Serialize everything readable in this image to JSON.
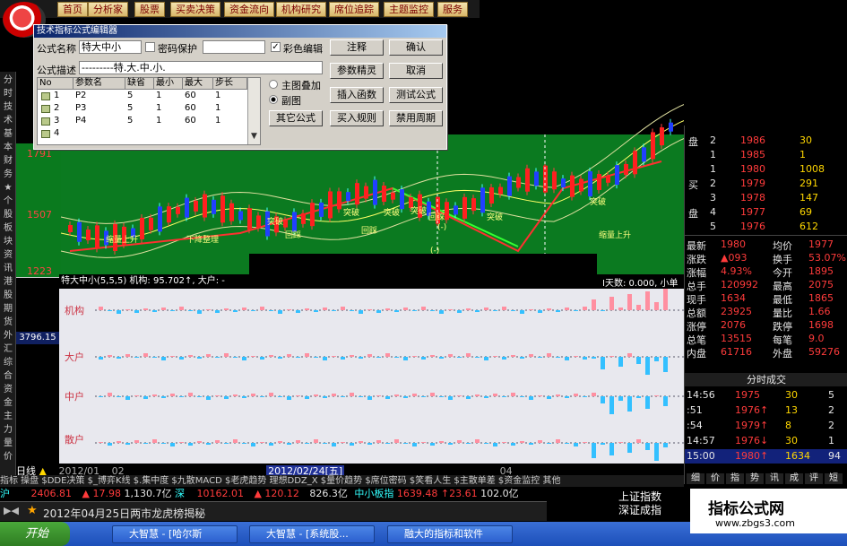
{
  "top_menu": [
    "首页",
    "分析家",
    "股票",
    "买卖决策",
    "资金流向",
    "机构研究",
    "席位追踪",
    "主题监控",
    "服务"
  ],
  "dialog": {
    "title": "技术指标公式编辑器",
    "name_label": "公式名称",
    "name_value": "特大中小",
    "password_label": "密码保护",
    "color_edit_label": "彩色编辑",
    "desc_label": "公式描述",
    "desc_value": "---------特.大.中.小.",
    "buttons": [
      "注释",
      "确认",
      "参数精灵",
      "取消",
      "插入函数",
      "测试公式",
      "其它公式",
      "买入规则",
      "禁用周期"
    ],
    "radio_main": "主图叠加",
    "radio_sub": "副图",
    "table_headers": [
      "No",
      "参数名",
      "缺省",
      "最小",
      "最大",
      "步长"
    ],
    "table_rows": [
      [
        "1",
        "P2",
        "5",
        "1",
        "60",
        "1"
      ],
      [
        "2",
        "P3",
        "5",
        "1",
        "60",
        "1"
      ],
      [
        "3",
        "P4",
        "5",
        "1",
        "60",
        "1"
      ],
      [
        "4",
        "",
        "",
        "",
        "",
        ""
      ]
    ]
  },
  "chart": {
    "prices": [
      "1791",
      "1507",
      "1223"
    ],
    "left_value": "3796.15",
    "annotations": [
      "突破",
      "回踩",
      "突破",
      "回踩",
      "突破",
      "突破",
      "回踩",
      "突破",
      "(-)",
      "(-)",
      "突破",
      "缩量上升",
      "下降整理",
      "缩量上升",
      "突破"
    ],
    "lower_header": "特大中小(5,5,5) 机构: 95.702↑, 大户: -",
    "lower_header_right": "I天数: 0.000, 小单",
    "lower_labels": [
      "机构",
      "大户",
      "中户",
      "散户"
    ]
  },
  "timeline": {
    "period_label": "日线",
    "dates": [
      "2012/01",
      "02",
      "2012/02/24[五]",
      "04"
    ]
  },
  "tabs": "指标 操盘 $DDE决策 $_博弈K线 $.集中度 $九散MACD $老虎趋势 理想DDZ_X $量价趋势 $席位密码 $笑看人生 $主散单差 $资金监控  其他",
  "index_bar": {
    "hu_label": "沪",
    "hu_value": "2406.81",
    "hu_change": "▲ 17.98",
    "hu_amount": "1,130.7亿",
    "shen_label": "深",
    "shen_value": "10162.01",
    "shen_change": "▲ 120.12",
    "shen_amount": "826.3亿",
    "zx_label": "中小板指",
    "zx_value": "1639.48",
    "zx_change": "↑23.61",
    "zx_amount": "102.0亿"
  },
  "news": "2012年04月25日两市龙虎榜揭秘",
  "taskbar": {
    "start": "开始",
    "tasks": [
      "大智慧 - [哈尔斯",
      "大智慧 - [系统股...",
      "融大的指标和软件"
    ]
  },
  "watermark": {
    "line1": "指标公式网",
    "line2": "www.zbgs3.com"
  },
  "right_panel": {
    "order_rows": [
      {
        "side": "盘",
        "n": "2",
        "price": "1986",
        "vol": "30"
      },
      {
        "side": "",
        "n": "1",
        "price": "1985",
        "vol": "1"
      },
      {
        "side": "",
        "n": "1",
        "price": "1980",
        "vol": "1008"
      },
      {
        "side": "买",
        "n": "2",
        "price": "1979",
        "vol": "291"
      },
      {
        "side": "",
        "n": "3",
        "price": "1978",
        "vol": "147"
      },
      {
        "side": "盘",
        "n": "4",
        "price": "1977",
        "vol": "69"
      },
      {
        "side": "",
        "n": "5",
        "price": "1976",
        "vol": "612"
      }
    ],
    "stats": [
      {
        "k1": "最新",
        "v1": "1980",
        "k2": "均价",
        "v2": "1977"
      },
      {
        "k1": "涨跌",
        "v1": "▲093",
        "k2": "换手",
        "v2": "53.07%"
      },
      {
        "k1": "涨幅",
        "v1": "4.93%",
        "k2": "今开",
        "v2": "1895"
      },
      {
        "k1": "总手",
        "v1": "120992",
        "k2": "最高",
        "v2": "2075"
      },
      {
        "k1": "现手",
        "v1": "1634",
        "k2": "最低",
        "v2": "1865"
      },
      {
        "k1": "总额",
        "v1": "23925",
        "k2": "量比",
        "v2": "1.66"
      },
      {
        "k1": "涨停",
        "v1": "2076",
        "k2": "跌停",
        "v2": "1698"
      },
      {
        "k1": "总笔",
        "v1": "13515",
        "k2": "每笔",
        "v2": "9.0"
      },
      {
        "k1": "内盘",
        "v1": "61716",
        "k2": "外盘",
        "v2": "59276"
      }
    ],
    "ticks_title": "分时成交",
    "ticks": [
      {
        "t": "14:56",
        "p": "1975",
        "v": "30",
        "n": "5"
      },
      {
        "t": ":51",
        "p": "1976↑",
        "v": "13",
        "n": "2"
      },
      {
        "t": ":54",
        "p": "1979↑",
        "v": "8",
        "n": "2"
      },
      {
        "t": "14:57",
        "p": "1976↓",
        "v": "30",
        "n": "1"
      },
      {
        "t": "15:00",
        "p": "1980↑",
        "v": "1634",
        "n": "94"
      }
    ],
    "bottom_tabs": [
      "细",
      "价",
      "指",
      "势",
      "讯",
      "成",
      "评",
      "短"
    ],
    "index_text1": "上证指数",
    "index_text2": "深证成指"
  }
}
